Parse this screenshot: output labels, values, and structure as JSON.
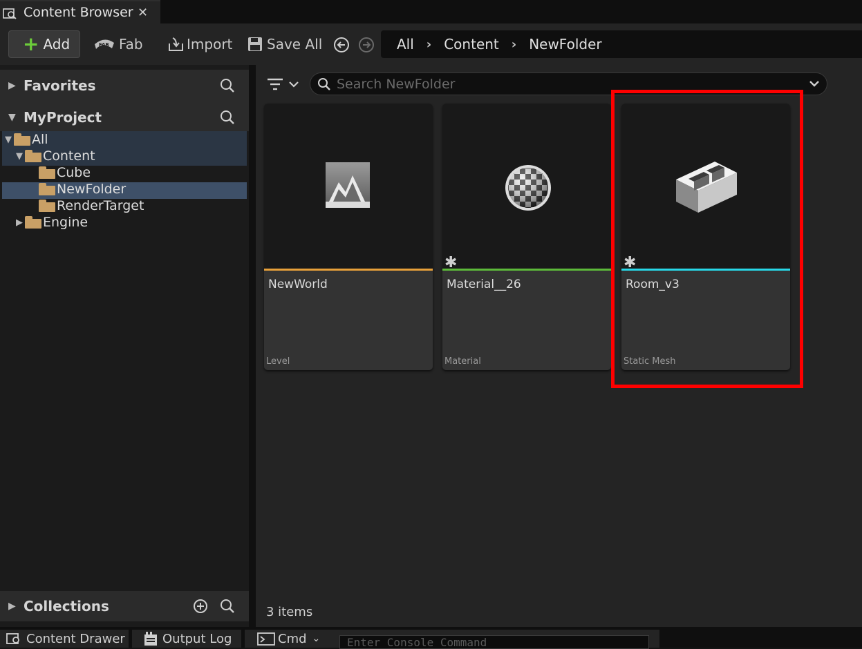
{
  "window": {
    "tab_title": "Content Browser",
    "close_glyph": "✕"
  },
  "toolbar": {
    "add_label": "Add",
    "fab_label": "Fab",
    "import_label": "Import",
    "save_all_label": "Save All",
    "breadcrumb": [
      "All",
      "Content",
      "NewFolder"
    ]
  },
  "sidebar": {
    "favorites_label": "Favorites",
    "project_label": "MyProject",
    "tree": [
      {
        "label": "All",
        "depth": 0,
        "expanded": true
      },
      {
        "label": "Content",
        "depth": 1,
        "expanded": true
      },
      {
        "label": "Cube",
        "depth": 2
      },
      {
        "label": "NewFolder",
        "depth": 2,
        "selected": true
      },
      {
        "label": "RenderTarget",
        "depth": 2
      },
      {
        "label": "Engine",
        "depth": 1,
        "expanded": false
      }
    ],
    "collections_label": "Collections"
  },
  "content": {
    "search_placeholder": "Search NewFolder",
    "assets": [
      {
        "name": "NewWorld",
        "type": "Level",
        "color": "#e8a13a",
        "icon": "level-icon",
        "modified": false
      },
      {
        "name": "Material__26",
        "type": "Material",
        "color": "#5dbb3a",
        "icon": "material-icon",
        "modified": true
      },
      {
        "name": "Room_v3",
        "type": "Static Mesh",
        "color": "#28d8e8",
        "icon": "static-mesh-icon",
        "modified": true
      }
    ],
    "item_count": "3 items",
    "highlight_color": "#ff0000"
  },
  "bottom": {
    "content_drawer_label": "Content Drawer",
    "output_log_label": "Output Log",
    "cmd_label": "Cmd",
    "console_placeholder": "Enter Console Command"
  }
}
